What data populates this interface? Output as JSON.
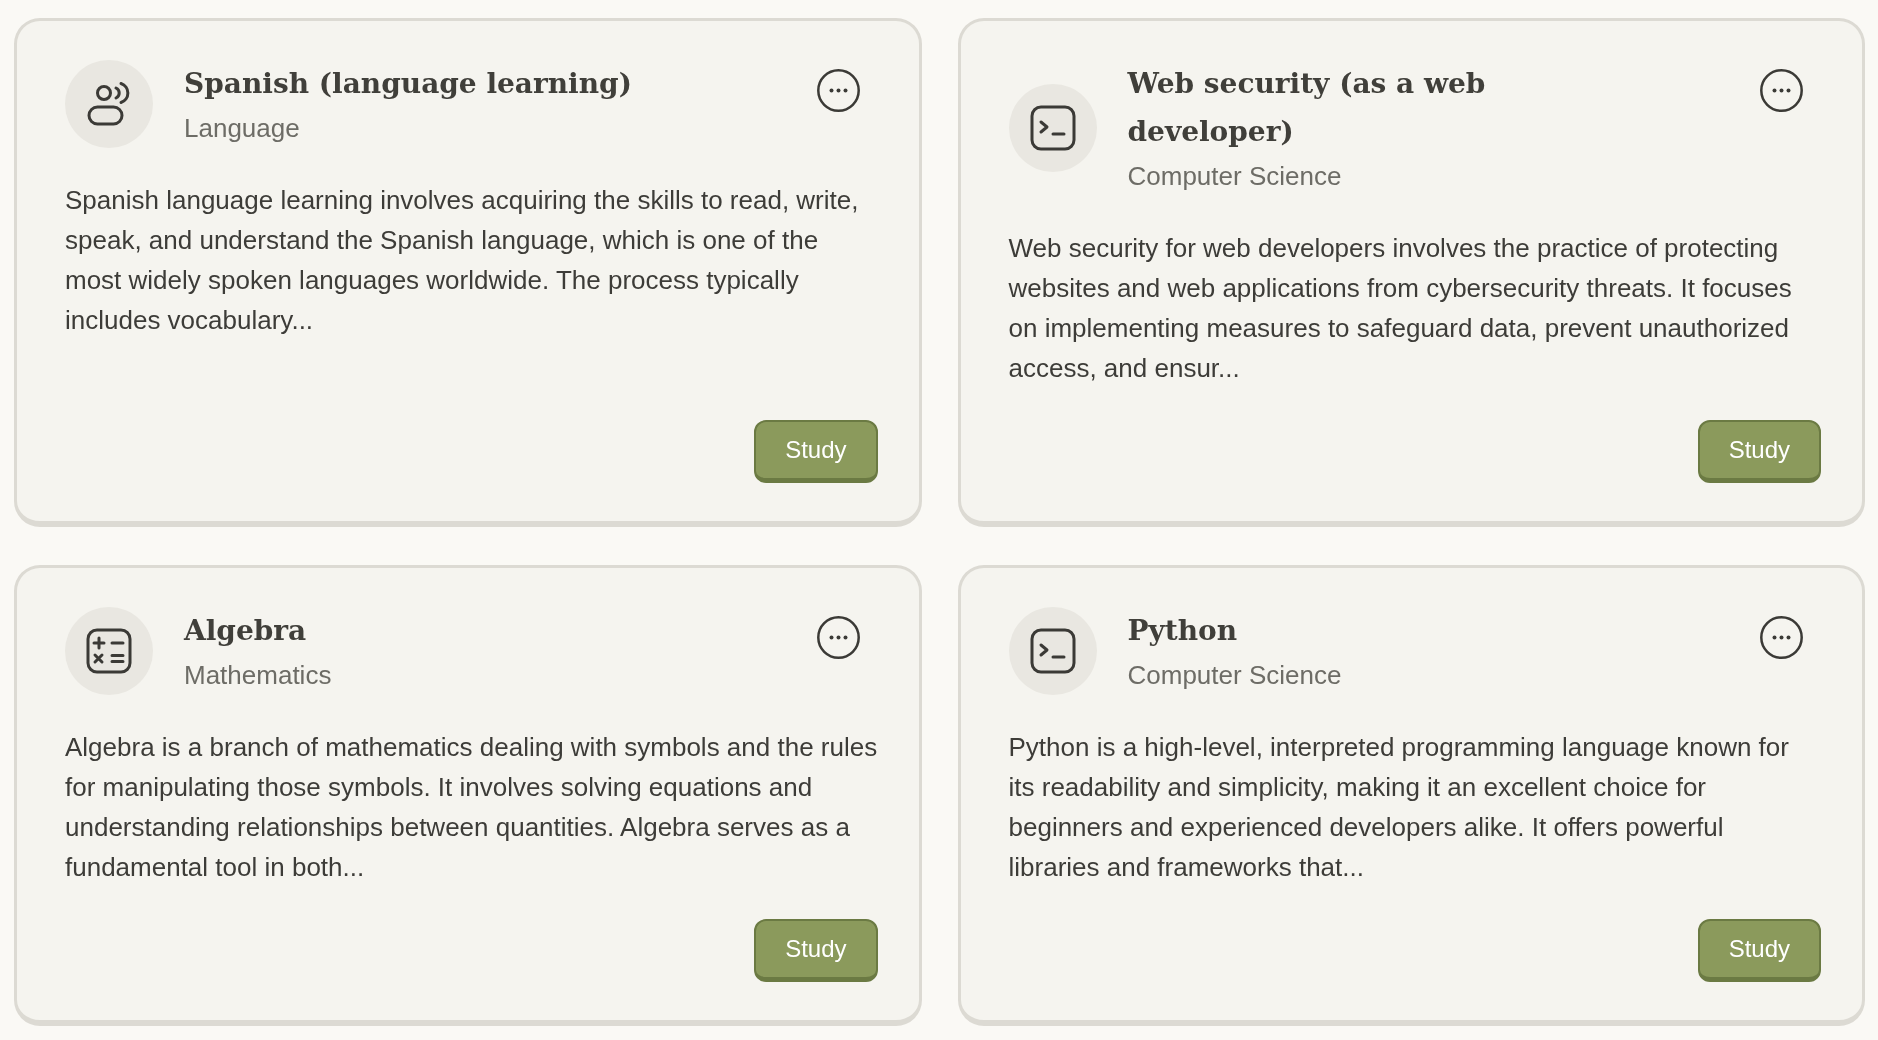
{
  "cards": [
    {
      "kind": "speech",
      "title": "Spanish (language learning)",
      "category": "Language",
      "description": "Spanish language learning involves acquiring the skills to read, write, speak, and understand the Spanish language, which is one of the most widely spoken languages worldwide. The process typically includes vocabulary...",
      "action": "Study"
    },
    {
      "kind": "code",
      "title": "Web security (as a web developer)",
      "category": "Computer Science",
      "description": "Web security for web developers involves the practice of protecting websites and web applications from cybersecurity threats. It focuses on implementing measures to safeguard data, prevent unauthorized access, and ensur...",
      "action": "Study"
    },
    {
      "kind": "math",
      "title": "Algebra",
      "category": "Mathematics",
      "description": "Algebra is a branch of mathematics dealing with symbols and the rules for manipulating those symbols. It involves solving equations and understanding relationships between quantities. Algebra serves as a fundamental tool in both...",
      "action": "Study"
    },
    {
      "kind": "code",
      "title": "Python",
      "category": "Computer Science",
      "description": "Python is a high-level, interpreted programming language known for its readability and simplicity, making it an excellent choice for beginners and experienced developers alike. It offers powerful libraries and frameworks that...",
      "action": "Study"
    }
  ]
}
